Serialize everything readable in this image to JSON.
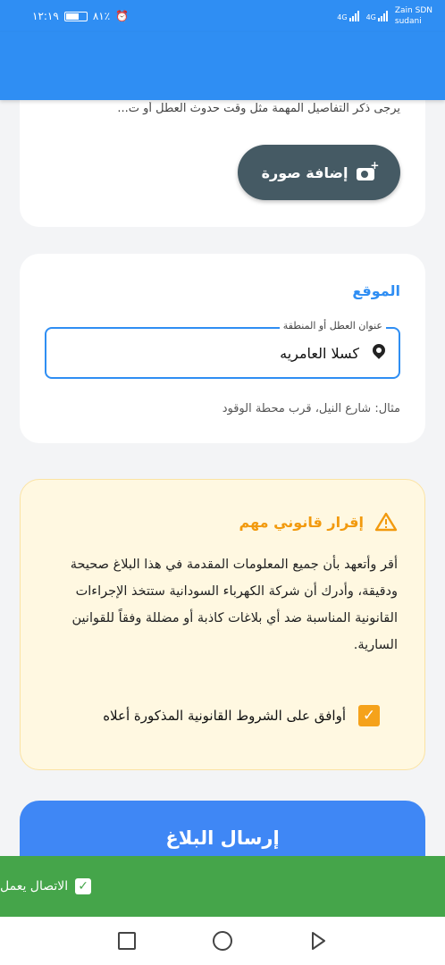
{
  "status_bar": {
    "time": "١٢:١٩",
    "battery": "٨١٪",
    "carrier_line1": "Zain SDN",
    "carrier_line2": "sudani",
    "signal_label": "4G"
  },
  "photo_card": {
    "hint": "يرجى ذكر التفاصيل المهمة مثل وقت حدوث العطل أو ت...",
    "add_photo_label": "إضافة صورة"
  },
  "location_card": {
    "title": "الموقع",
    "field_label": "عنوان العطل أو المنطقة",
    "field_value": "كسلا العامريه",
    "example": "مثال: شارع النيل، قرب محطة الوقود"
  },
  "legal_card": {
    "title": "إقرار قانوني مهم",
    "text": "أقر وأتعهد بأن جميع المعلومات المقدمة في هذا البلاغ صحيحة ودقيقة، وأدرك أن شركة الكهرباء السودانية ستتخذ الإجراءات القانونية المناسبة ضد أي بلاغات كاذبة أو مضللة وفقاً للقوانين السارية.",
    "agree_label": "أوافق على الشروط القانونية المذكورة أعلاه",
    "agree_checked": true,
    "accent_color": "#f29a0e"
  },
  "submit_label": "إرسال البلاغ",
  "snackbar": {
    "message": "الاتصال يعمل"
  },
  "colors": {
    "primary": "#2f8ef3",
    "success": "#45a54a",
    "dark_button": "#455a64"
  }
}
